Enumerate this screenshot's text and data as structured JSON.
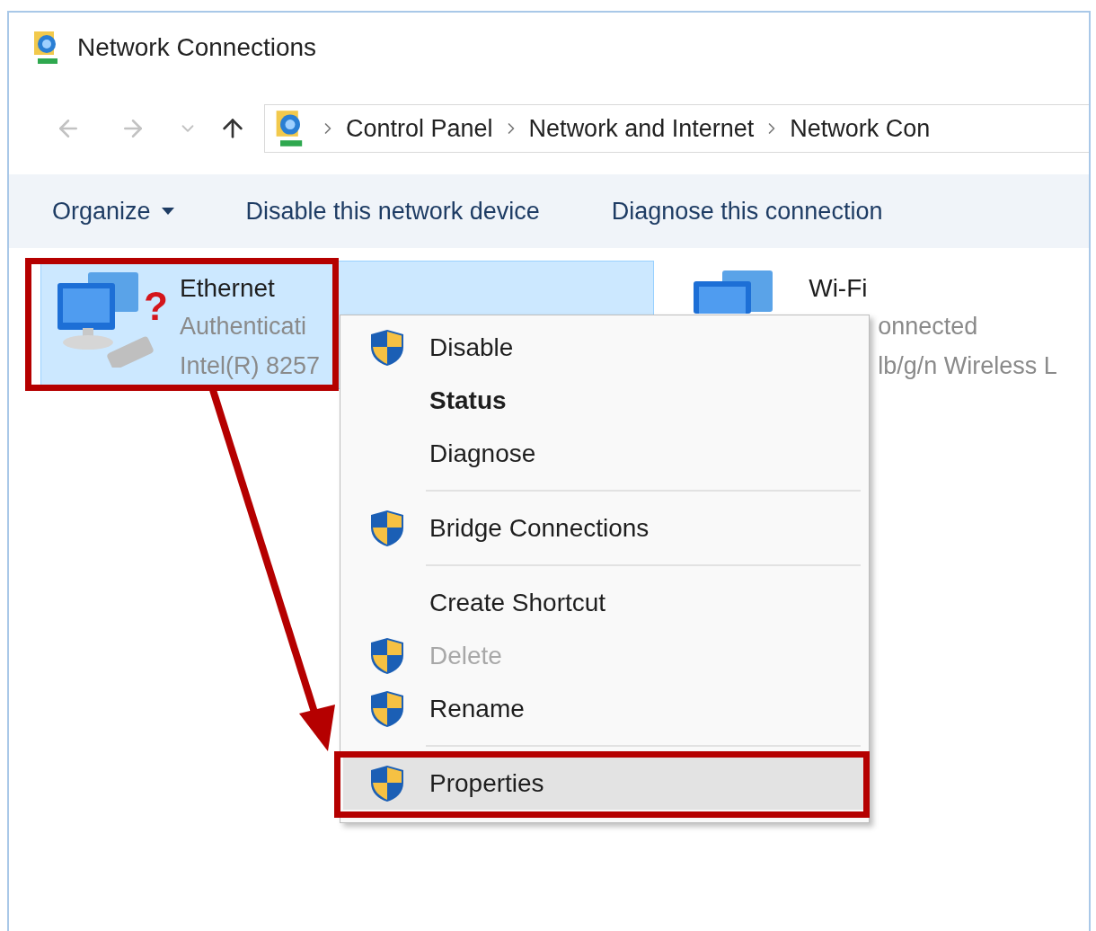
{
  "window": {
    "title": "Network Connections"
  },
  "address_bar": {
    "path": [
      "Control Panel",
      "Network and Internet",
      "Network Con"
    ]
  },
  "toolbar": {
    "buttons": [
      {
        "label": "Organize",
        "dropdown": true
      },
      {
        "label": "Disable this network device",
        "dropdown": false
      },
      {
        "label": "Diagnose this connection",
        "dropdown": false
      }
    ]
  },
  "connections": [
    {
      "name": "Ethernet",
      "status": "Authenticati",
      "device": "Intel(R) 8257",
      "selected": true,
      "badge": "?"
    },
    {
      "name": "Wi-Fi",
      "status": "onnected",
      "device": "lb/g/n Wireless L",
      "selected": false
    }
  ],
  "context_menu": {
    "items": [
      {
        "kind": "item",
        "label": "Disable",
        "shield": true,
        "default": false,
        "disabled": false,
        "selected": false
      },
      {
        "kind": "item",
        "label": "Status",
        "shield": false,
        "default": true,
        "disabled": false,
        "selected": false
      },
      {
        "kind": "item",
        "label": "Diagnose",
        "shield": false,
        "default": false,
        "disabled": false,
        "selected": false
      },
      {
        "kind": "separator"
      },
      {
        "kind": "item",
        "label": "Bridge Connections",
        "shield": true,
        "default": false,
        "disabled": false,
        "selected": false
      },
      {
        "kind": "separator"
      },
      {
        "kind": "item",
        "label": "Create Shortcut",
        "shield": false,
        "default": false,
        "disabled": false,
        "selected": false
      },
      {
        "kind": "item",
        "label": "Delete",
        "shield": true,
        "default": false,
        "disabled": true,
        "selected": false
      },
      {
        "kind": "item",
        "label": "Rename",
        "shield": true,
        "default": false,
        "disabled": false,
        "selected": false
      },
      {
        "kind": "separator"
      },
      {
        "kind": "item",
        "label": "Properties",
        "shield": true,
        "default": false,
        "disabled": false,
        "selected": true
      }
    ]
  }
}
